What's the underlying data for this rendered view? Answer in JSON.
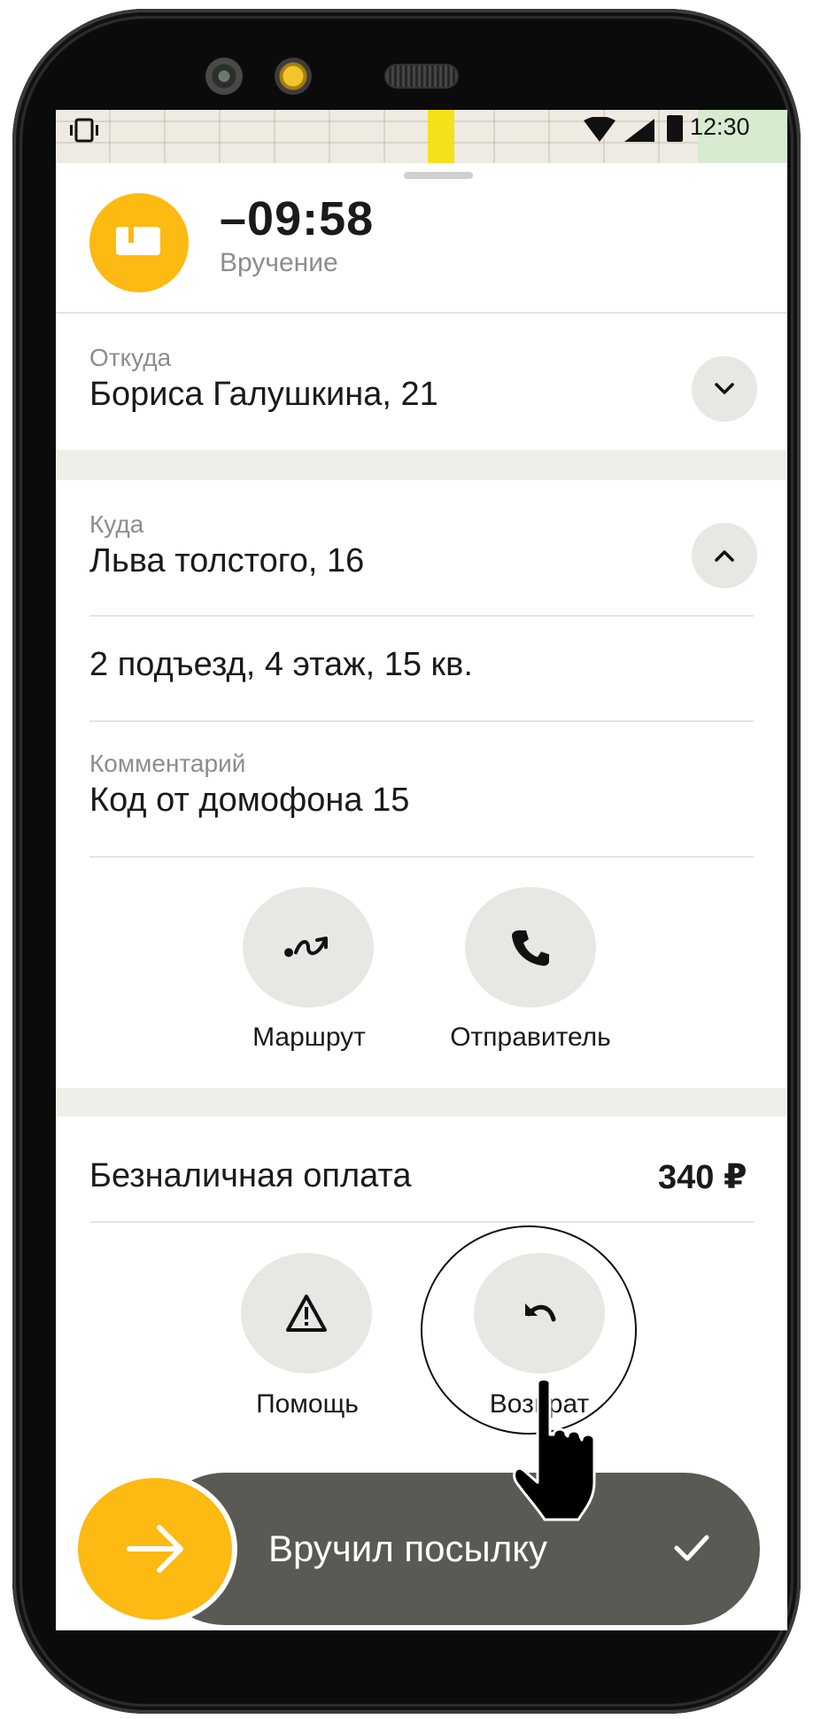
{
  "status_bar": {
    "time": "12:30"
  },
  "order": {
    "timer": "–09:58",
    "status": "Вручение"
  },
  "pickup": {
    "label": "Откуда",
    "address": "Бориса Галушкина, 21"
  },
  "dropoff": {
    "label": "Куда",
    "address": "Льва толстого, 16",
    "details": "2 подъезд, 4 этаж, 15 кв.",
    "comment_label": "Комментарий",
    "comment": "Код от домофона 15"
  },
  "actions_top": [
    {
      "label": "Маршрут",
      "icon": "route-icon"
    },
    {
      "label": "Отправитель",
      "icon": "phone-icon"
    }
  ],
  "payment": {
    "label": "Безналичная оплата",
    "amount": "340 ₽"
  },
  "actions_bottom": [
    {
      "label": "Помощь",
      "icon": "warning-icon"
    },
    {
      "label": "Возврат",
      "icon": "undo-icon"
    }
  ],
  "confirm_slider": {
    "label": "Вручил посылку"
  },
  "colors": {
    "accent": "#fcba12",
    "slider": "#5a5954",
    "band": "#efeee9"
  }
}
